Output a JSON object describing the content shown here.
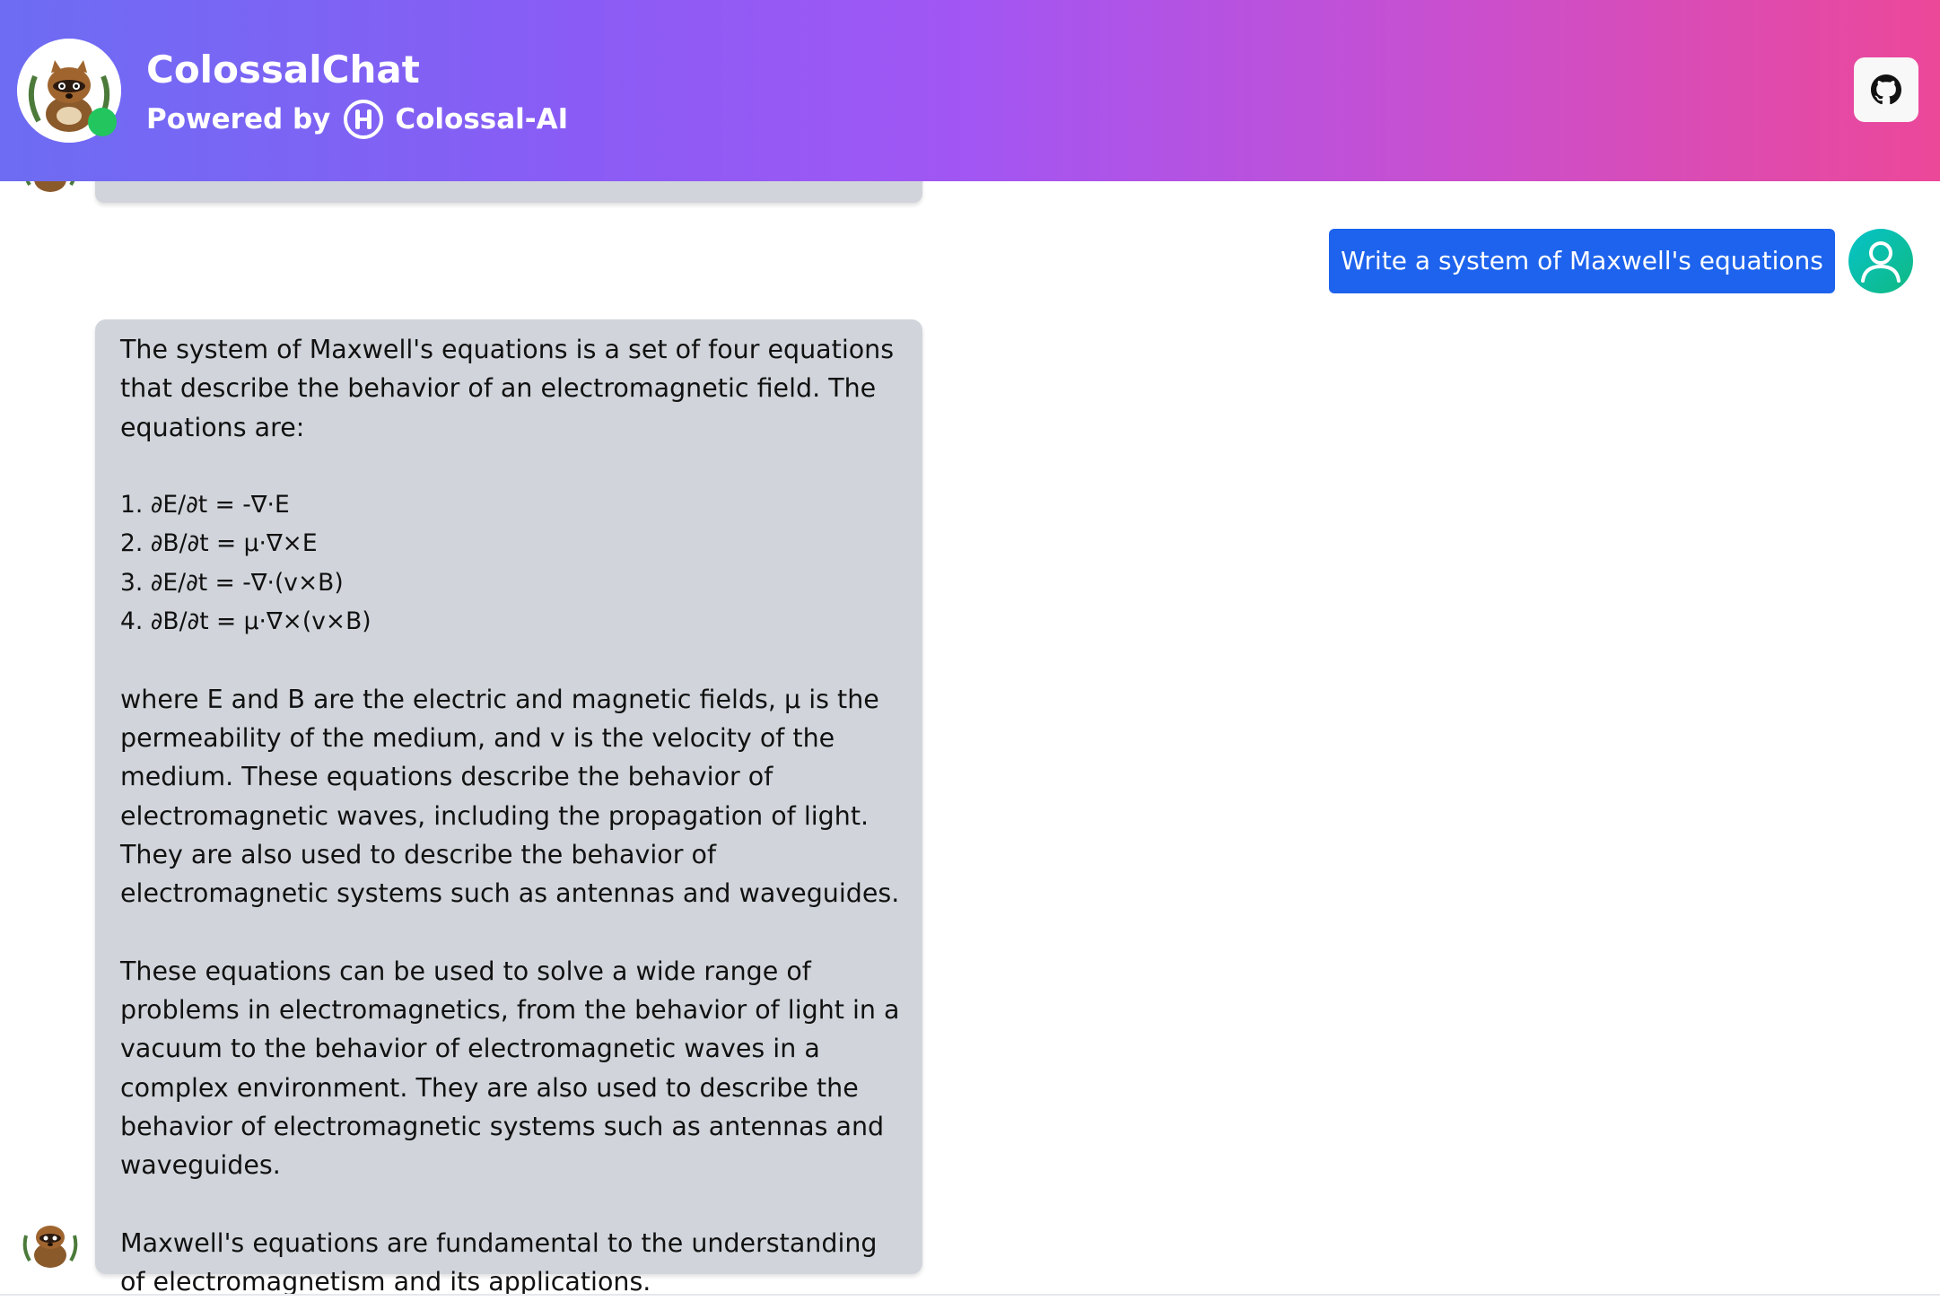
{
  "header": {
    "title": "ColossalChat",
    "powered_by": "Powered by",
    "brand": "Colossal-AI",
    "github_icon": "github-icon",
    "colors": {
      "gradient_start": "#6d6cf3",
      "gradient_end": "#ec4899",
      "online": "#22c55e"
    }
  },
  "conversation": {
    "user_message": "Write a system of Maxwell's equations",
    "bot_reply": {
      "intro": "The system of Maxwell's equations is a set of four equations that describe the behavior of an electromagnetic field. The equations are:",
      "equations": [
        "1. ∂E/∂t = -∇·E",
        "2. ∂B/∂t = μ·∇×E",
        "3. ∂E/∂t = -∇·(v×B)",
        "4. ∂B/∂t = μ·∇×(v×B)"
      ],
      "paragraph_1": "where E and B are the electric and magnetic fields, μ is the permeability of the medium, and v is the velocity of the medium. These equations describe the behavior of electromagnetic waves, including the propagation of light. They are also used to describe the behavior of electromagnetic systems such as antennas and waveguides.",
      "paragraph_2": "These equations can be used to solve a wide range of problems in electromagnetics, from the behavior of light in a vacuum to the behavior of electromagnetic waves in a complex environment. They are also used to describe the behavior of electromagnetic systems such as antennas and waveguides.",
      "paragraph_3": "Maxwell's equations are fundamental to the understanding of electromagnetism and its applications."
    },
    "colors": {
      "user_bubble": "#1d63ed",
      "bot_bubble": "#d1d5db"
    }
  }
}
